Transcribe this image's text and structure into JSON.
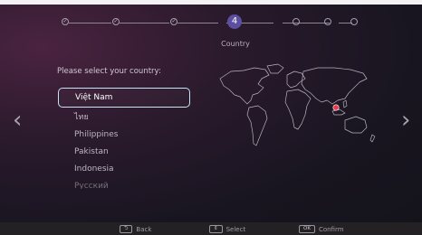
{
  "stepper": {
    "completed_mark": "✓",
    "current_number": "4",
    "current_label": "Country"
  },
  "prompt": "Please select your country:",
  "countries": [
    "Việt Nam",
    "ไทย",
    "Philippines",
    "Pakistan",
    "Indonesia",
    "Русский"
  ],
  "selected_country": "Việt Nam",
  "map": {
    "marker_color": "#e83a4a",
    "outline_color": "#b9b3bd"
  },
  "hints": {
    "back": {
      "key": "⮌",
      "label": "Back"
    },
    "select": {
      "key": "⇕",
      "label": "Select"
    },
    "confirm": {
      "key": "OK",
      "label": "Confirm"
    }
  },
  "colors": {
    "accent": "#5c4ea0",
    "highlight_border": "#c6e4f3"
  }
}
